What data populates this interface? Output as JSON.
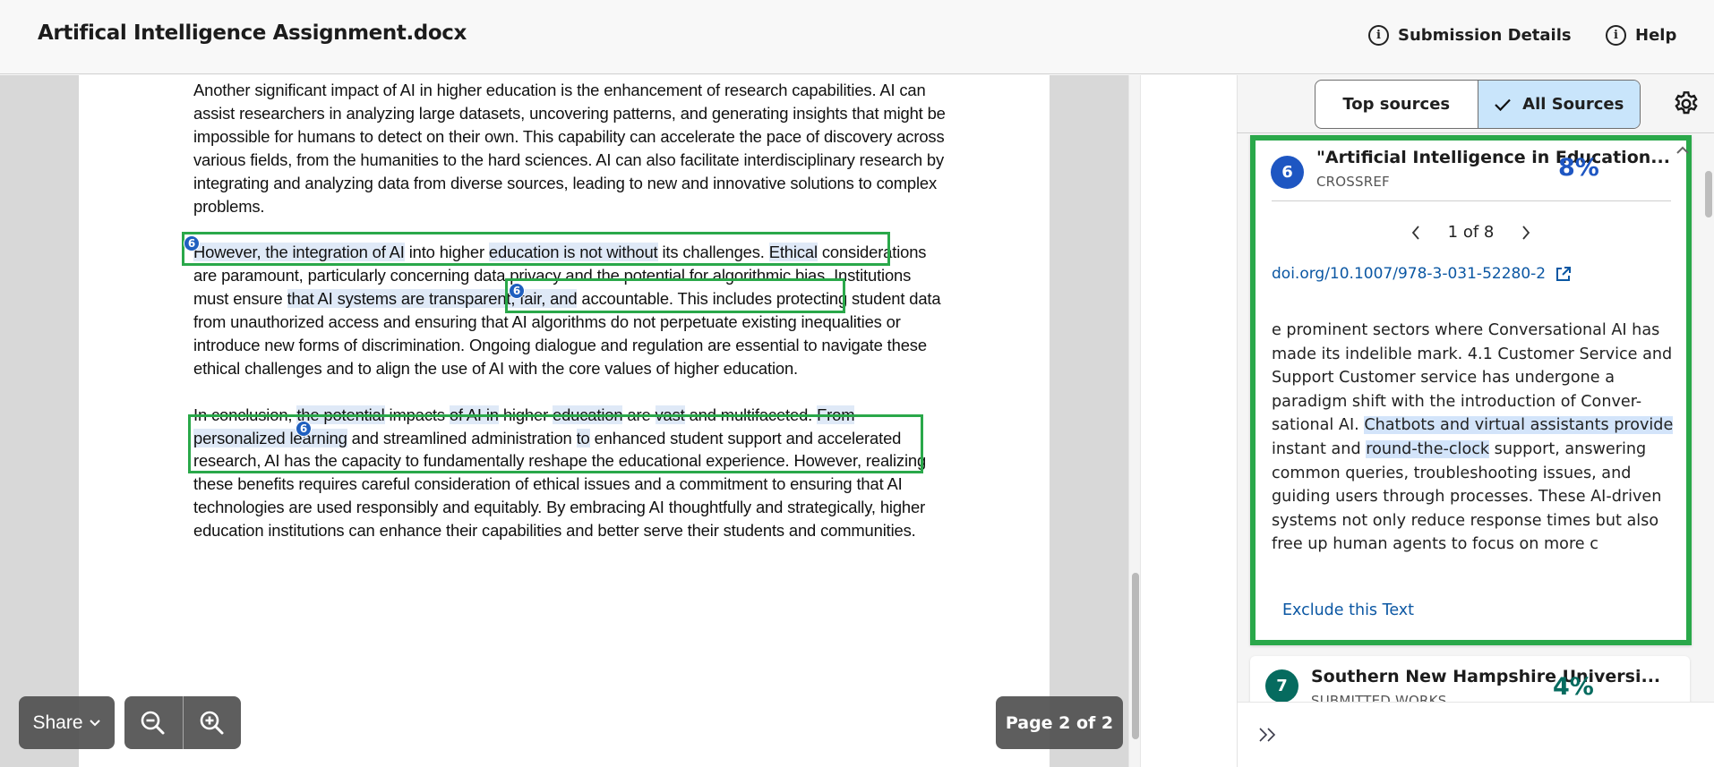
{
  "header": {
    "title": "Artifical Intelligence Assignment.docx",
    "submission_details_label": "Submission Details",
    "help_label": "Help"
  },
  "document": {
    "paragraphs": [
      {
        "segments": [
          {
            "text": "Another significant impact of AI in higher education is the enhancement of research capabilities. AI can assist researchers in analyzing large datasets, uncovering patterns, and generating insights that might be impossible for humans to detect on their own. This capability can accelerate the pace of discovery across various fields, from the humanities to the hard sciences. AI can also facilitate interdisciplinary research by integrating and analyzing data from diverse sources, leading to new and innovative solutions to complex problems.",
            "highlight": false
          }
        ]
      },
      {
        "segments": [
          {
            "text": "However, the integration of AI",
            "highlight": true
          },
          {
            "text": " into higher ",
            "highlight": false
          },
          {
            "text": "education is not without",
            "highlight": true
          },
          {
            "text": " its challenges. ",
            "highlight": false
          },
          {
            "text": "Ethical",
            "highlight": true
          },
          {
            "text": " considerations are paramount, particularly concerning data privacy and the potential for algorithmic bias. Institutions must ensure ",
            "highlight": false
          },
          {
            "text": "that AI systems are transparent, fair, and",
            "highlight": true
          },
          {
            "text": " accountable. This includes protecting student data from unauthorized access and ensuring that AI algorithms do not perpetuate existing inequalities or introduce new forms of discrimination. Ongoing dialogue and regulation are essential to navigate these ethical challenges and to align the use of AI with the core values of higher education.",
            "highlight": false
          }
        ]
      },
      {
        "segments": [
          {
            "text": "In conclusion, ",
            "highlight": false
          },
          {
            "text": "the potential",
            "highlight": true
          },
          {
            "text": " impacts ",
            "highlight": false
          },
          {
            "text": "of AI in",
            "highlight": true
          },
          {
            "text": " higher ",
            "highlight": false
          },
          {
            "text": "education",
            "highlight": true
          },
          {
            "text": " are ",
            "highlight": false
          },
          {
            "text": "vast",
            "highlight": true
          },
          {
            "text": " and multifaceted. ",
            "highlight": false
          },
          {
            "text": "From personalized learning",
            "highlight": true
          },
          {
            "text": " and streamlined administration ",
            "highlight": false
          },
          {
            "text": "to",
            "highlight": true
          },
          {
            "text": " enhanced student support and accelerated research, AI has the capacity to fundamentally reshape the educational experience. However, realizing these benefits requires careful consideration of ethical issues and a commitment to ensuring that AI technologies are used responsibly and equitably. By embracing AI thoughtfully and strategically, higher education institutions can enhance their capabilities and better serve their students and communities.",
            "highlight": false
          }
        ]
      }
    ],
    "citation_badges": [
      "6",
      "6",
      "6"
    ],
    "colors": {
      "match_box": "#2aa84a",
      "highlight": "#dfe9f7",
      "badge": "#1f5fbf"
    }
  },
  "controls": {
    "share_label": "Share",
    "zoom_out_icon": "zoom-out-icon",
    "zoom_in_icon": "zoom-in-icon",
    "page_indicator": "Page 2 of 2"
  },
  "side_panel": {
    "filter": {
      "top_sources_label": "Top sources",
      "all_sources_label": "All Sources",
      "active": "All Sources"
    },
    "sources": [
      {
        "number": "6",
        "title": "\"Artificial Intelligence in Education...",
        "type": "CROSSREF",
        "percent": "8%",
        "color": "#1e56c2",
        "expanded": true,
        "pager": "1 of 8",
        "link": "doi.org/10.1007/978-3-031-52280-2",
        "excerpt": [
          {
            "text": "e prominent sectors where Conversational AI has made its indelible mark. 4.1 Customer Service and Support Customer service has undergone a paradigm shift with the introduction of Conver-sational AI. ",
            "highlight": false
          },
          {
            "text": "Chatbots and virtual assistants provide",
            "highlight": true
          },
          {
            "text": " instant and ",
            "highlight": false
          },
          {
            "text": "round-the-clock",
            "highlight": true
          },
          {
            "text": " support, answering common queries, troubleshooting issues, and guiding users through processes. These AI-driven systems not only reduce response times but also free up human agents to focus on more c",
            "highlight": false
          }
        ],
        "exclude_label": "Exclude this Text"
      },
      {
        "number": "7",
        "title": "Southern New Hampshire Universi...",
        "type": "SUBMITTED WORKS",
        "percent": "4%",
        "color": "#066b5f",
        "expanded": false
      }
    ]
  }
}
